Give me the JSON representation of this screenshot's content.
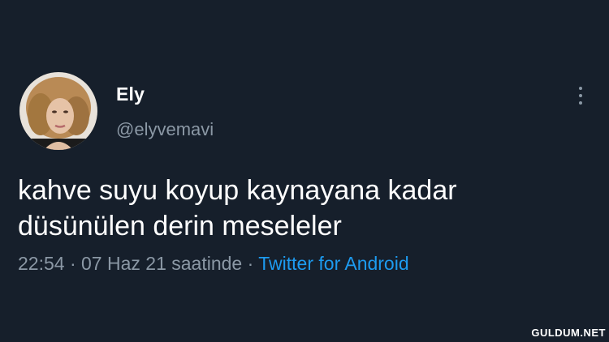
{
  "tweet": {
    "display_name": "Ely",
    "handle": "@elyvemavi",
    "text_line1": "kahve suyu koyup kaynayana kadar",
    "text_line2": "düsünülen derin meseleler",
    "time": "22:54",
    "date": "07 Haz 21 saatinde",
    "separator": "·",
    "source": "Twitter for Android"
  },
  "icons": {
    "more": "more-vertical-icon",
    "avatar": "avatar"
  },
  "colors": {
    "background": "#161f2b",
    "secondary_text": "#8b98a5",
    "link": "#1d9bf0"
  },
  "watermark": "GULDUM.NET"
}
